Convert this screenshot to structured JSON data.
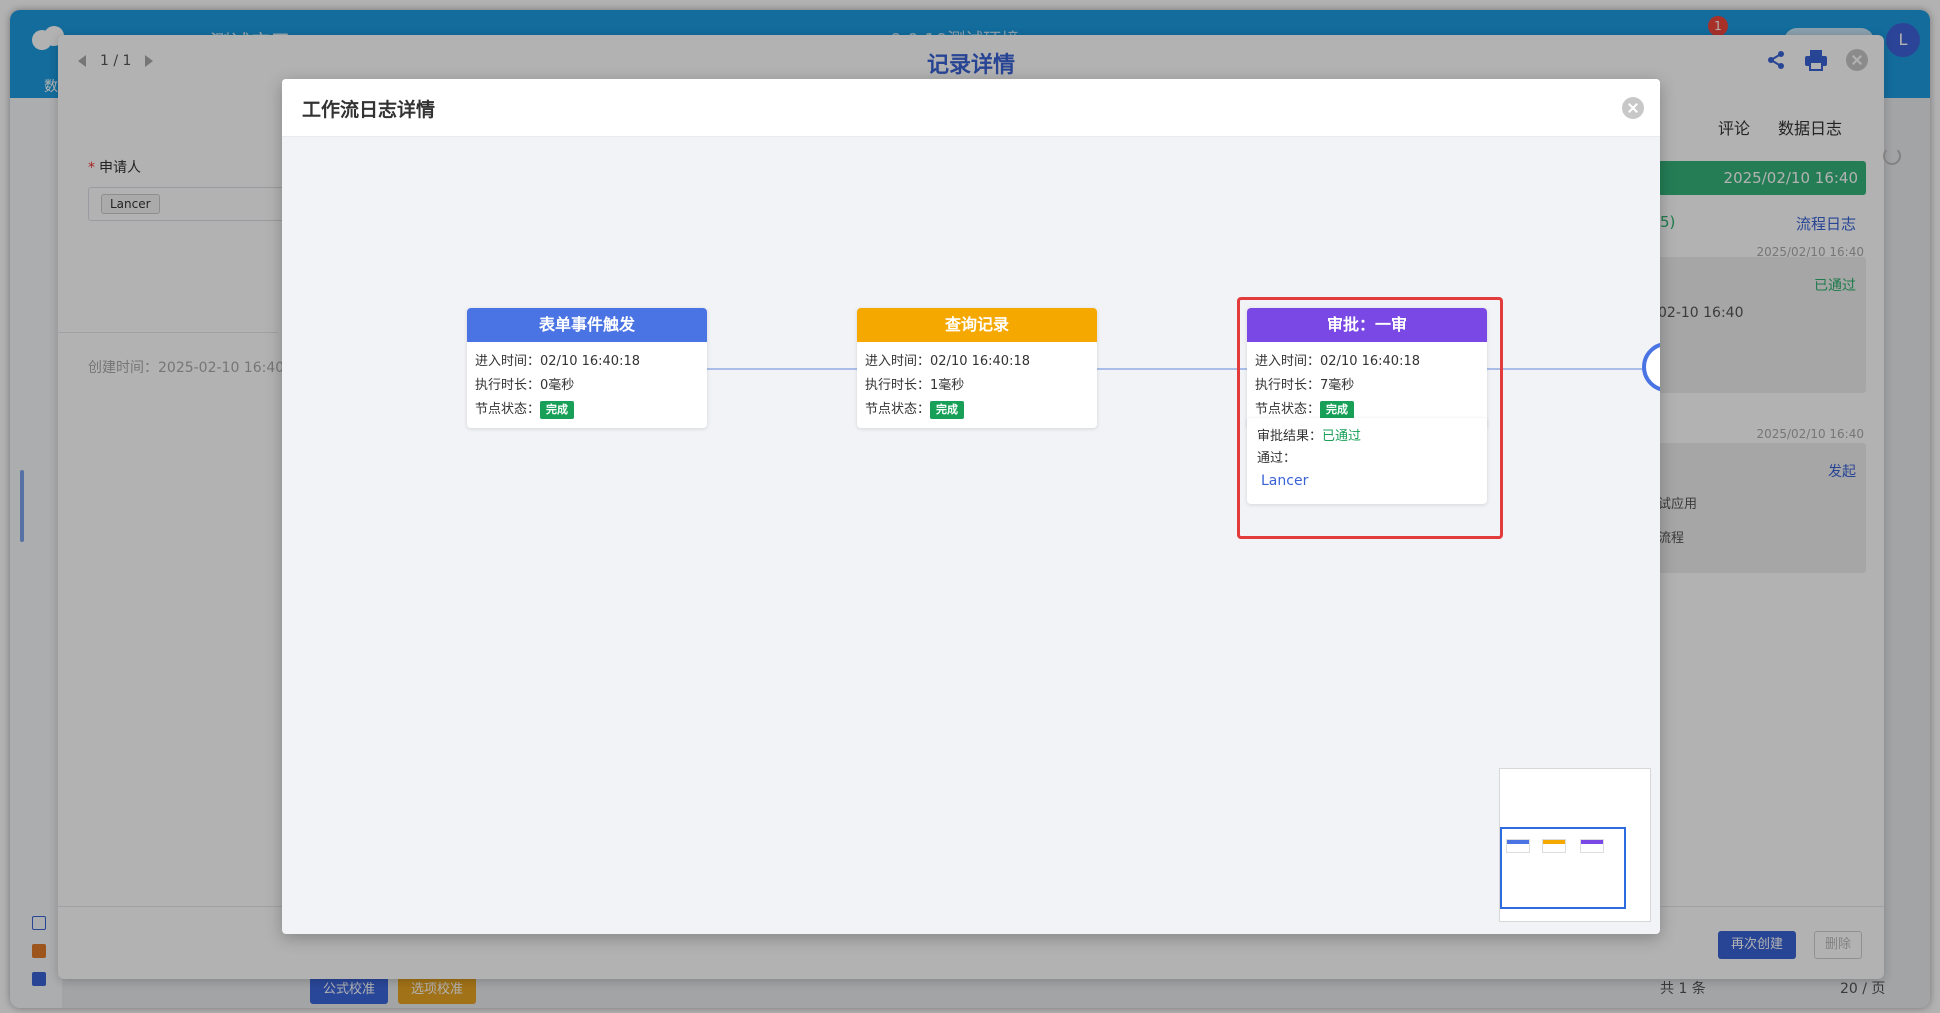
{
  "app": {
    "title": "测试应用",
    "center_title": "0.0.10测试环境",
    "tab_stub": "数",
    "notification_count": "1",
    "user_initial": "L",
    "footer_buttons": [
      "公式校准",
      "选项校准"
    ],
    "pagination_text": "共 1 条",
    "page_size": "20 / 页"
  },
  "record": {
    "title": "记录详情",
    "pager": "1 / 1",
    "applicant_label": "申请人",
    "applicant_value": "Lancer",
    "created_time": "创建时间：2025-02-10 16:40:",
    "right_panel": {
      "tab_comment": "评论",
      "tab_datalog": "数据日志",
      "green_bar_time": "2025/02/10 16:40",
      "flowlog_fragment": "5)",
      "flowlog_link": "流程日志",
      "card1": {
        "time": "2025/02/10 16:40",
        "status": "已通过",
        "text": "02-10 16:40"
      },
      "card2": {
        "time": "2025/02/10 16:40",
        "status": "发起",
        "line1": "试应用",
        "line2": "流程"
      }
    },
    "buttons": {
      "recreate": "再次创建",
      "delete": "删除"
    }
  },
  "workflow_modal": {
    "title": "工作流日志详情",
    "nodes": [
      {
        "title": "表单事件触发",
        "color": "#4a74e4",
        "enter_label": "进入时间：",
        "enter_time": "02/10 16:40:18",
        "duration_label": "执行时长：",
        "duration": "0毫秒",
        "status_label": "节点状态：",
        "status": "完成"
      },
      {
        "title": "查询记录",
        "color": "#f5a800",
        "enter_label": "进入时间：",
        "enter_time": "02/10 16:40:18",
        "duration_label": "执行时长：",
        "duration": "1毫秒",
        "status_label": "节点状态：",
        "status": "完成"
      },
      {
        "title": "审批：一审",
        "color": "#7a48e5",
        "enter_label": "进入时间：",
        "enter_time": "02/10 16:40:18",
        "duration_label": "执行时长：",
        "duration": "7毫秒",
        "status_label": "节点状态：",
        "status": "完成",
        "approval": {
          "result_label": "审批结果：",
          "result": "已通过",
          "passed_label": "通过：",
          "approver": "Lancer"
        }
      }
    ]
  },
  "colors": {
    "accent": "#3a63d6",
    "done": "#18a058",
    "highlight": "#e33b3b",
    "header": "#1c9be0"
  }
}
